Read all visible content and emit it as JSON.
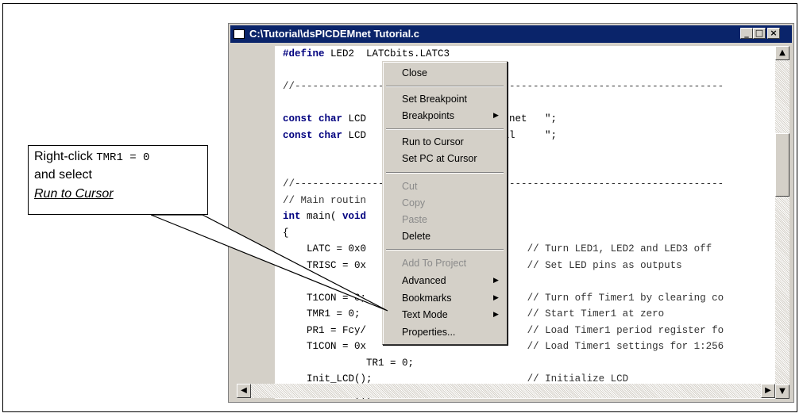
{
  "window": {
    "title": "C:\\Tutorial\\dsPICDEMnet Tutorial.c",
    "minimize": "_",
    "maximize": "□",
    "close": "×"
  },
  "code_lines": [
    {
      "parts": [
        {
          "t": "#define",
          "c": "kw"
        },
        {
          "t": " LED2  LATCbits.LATC3",
          "c": ""
        }
      ]
    },
    {
      "parts": [
        {
          "t": "",
          "c": ""
        }
      ]
    },
    {
      "parts": [
        {
          "t": "//------------------------------------------------------------------------",
          "c": "cm"
        }
      ]
    },
    {
      "parts": [
        {
          "t": "",
          "c": ""
        }
      ]
    },
    {
      "parts": [
        {
          "t": "const char",
          "c": "kw"
        },
        {
          "t": " LCD                   CDEM.net   \";",
          "c": ""
        }
      ]
    },
    {
      "parts": [
        {
          "t": "const char",
          "c": "kw"
        },
        {
          "t": " LCD                   torial     \";",
          "c": ""
        }
      ]
    },
    {
      "parts": [
        {
          "t": "",
          "c": ""
        }
      ]
    },
    {
      "parts": [
        {
          "t": "",
          "c": ""
        }
      ]
    },
    {
      "parts": [
        {
          "t": "//------------------------------------------------------------------------",
          "c": "cm"
        }
      ]
    },
    {
      "parts": [
        {
          "t": "// Main routin",
          "c": "cm"
        }
      ]
    },
    {
      "parts": [
        {
          "t": "int",
          "c": "kw"
        },
        {
          "t": " main( ",
          "c": ""
        },
        {
          "t": "void",
          "c": "kw"
        }
      ]
    },
    {
      "parts": [
        {
          "t": "{",
          "c": ""
        }
      ]
    },
    {
      "parts": [
        {
          "t": "    LATC = 0x0                           ",
          "c": ""
        },
        {
          "t": "// Turn LED1, LED2 and LED3 off",
          "c": "cm"
        }
      ]
    },
    {
      "parts": [
        {
          "t": "    TRISC = 0x                           ",
          "c": ""
        },
        {
          "t": "// Set LED pins as outputs",
          "c": "cm"
        }
      ]
    },
    {
      "parts": [
        {
          "t": "",
          "c": ""
        }
      ]
    },
    {
      "parts": [
        {
          "t": "    T1CON = 0;                           ",
          "c": ""
        },
        {
          "t": "// Turn off Timer1 by clearing co",
          "c": "cm"
        }
      ]
    },
    {
      "parts": [
        {
          "t": "    TMR1 = 0;                            ",
          "c": ""
        },
        {
          "t": "// Start Timer1 at zero",
          "c": "cm"
        }
      ]
    },
    {
      "parts": [
        {
          "t": "    PR1 = Fcy/                           ",
          "c": ""
        },
        {
          "t": "// Load Timer1 period register fo",
          "c": "cm"
        }
      ]
    },
    {
      "parts": [
        {
          "t": "    T1CON = 0x                           ",
          "c": ""
        },
        {
          "t": "// Load Timer1 settings for 1:256",
          "c": "cm"
        }
      ]
    },
    {
      "parts": [
        {
          "t": "              TR1 = 0;",
          "c": ""
        }
      ]
    },
    {
      "parts": [
        {
          "t": "    Init_LCD();                          ",
          "c": ""
        },
        {
          "t": "// Initialize LCD",
          "c": "cm"
        }
      ]
    },
    {
      "parts": [
        {
          "t": "    home_clr();                          ",
          "c": ""
        },
        {
          "t": "// Clear screen and home cursor",
          "c": "cm"
        }
      ]
    }
  ],
  "context_menu": {
    "items": [
      {
        "label": "Close",
        "disabled": false,
        "submenu": false
      },
      {
        "label": "Set Breakpoint",
        "disabled": false,
        "submenu": false
      },
      {
        "label": "Breakpoints",
        "disabled": false,
        "submenu": true
      },
      {
        "label": "Run to Cursor",
        "disabled": false,
        "submenu": false
      },
      {
        "label": "Set PC at Cursor",
        "disabled": false,
        "submenu": false
      },
      {
        "label": "Cut",
        "disabled": true,
        "submenu": false
      },
      {
        "label": "Copy",
        "disabled": true,
        "submenu": false
      },
      {
        "label": "Paste",
        "disabled": true,
        "submenu": false
      },
      {
        "label": "Delete",
        "disabled": false,
        "submenu": false
      },
      {
        "label": "Add To Project",
        "disabled": true,
        "submenu": false
      },
      {
        "label": "Advanced",
        "disabled": false,
        "submenu": true
      },
      {
        "label": "Bookmarks",
        "disabled": false,
        "submenu": true
      },
      {
        "label": "Text Mode",
        "disabled": false,
        "submenu": true
      },
      {
        "label": "Properties...",
        "disabled": false,
        "submenu": false
      }
    ],
    "submenu_arrow": "▶"
  },
  "callout": {
    "line1_prefix": "Right-click ",
    "line1_code": "TMR1 = 0",
    "line2": "and select",
    "line3": "Run to Cursor"
  },
  "scroll_arrows": {
    "up": "▲",
    "down": "▼",
    "left": "◀",
    "right": "▶"
  }
}
